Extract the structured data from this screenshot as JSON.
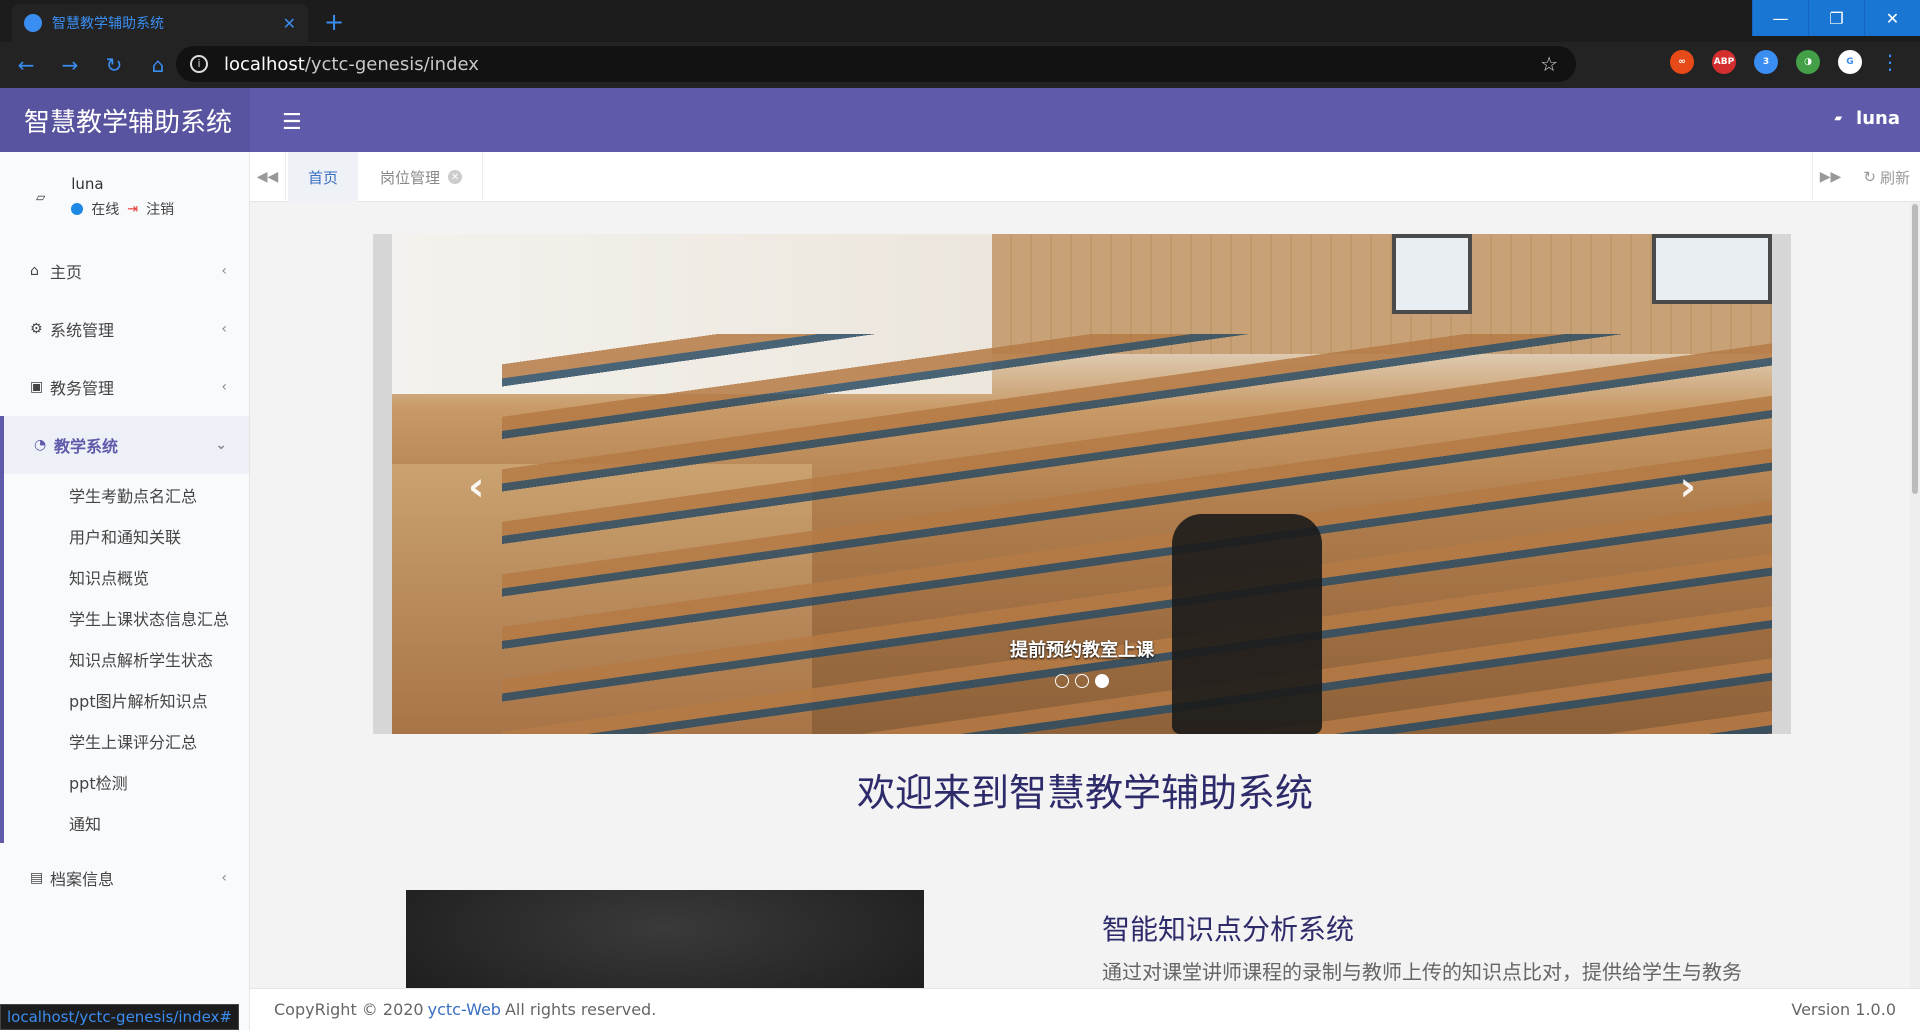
{
  "browser": {
    "tab_title": "智慧教学辅助系统",
    "tab_close": "✕",
    "new_tab": "+",
    "url_host": "localhost",
    "url_path": "/yctc-genesis/index",
    "status_url": "localhost/yctc-genesis/index#",
    "window_controls": {
      "minimize": "—",
      "maximize": "❐",
      "close": "✕"
    },
    "extensions": [
      {
        "name": "infinity-ext-icon",
        "label": "∞",
        "color": "#e64a19"
      },
      {
        "name": "adblock-icon",
        "label": "ABP",
        "color": "#d32f2f"
      },
      {
        "name": "extension-badge-icon",
        "label": "3",
        "color": "#3a8df1"
      },
      {
        "name": "color-ext-icon",
        "label": "◑",
        "color": "#43a047"
      },
      {
        "name": "translate-icon",
        "label": "G",
        "color": "#ffffff"
      }
    ]
  },
  "app": {
    "title": "智慧教学辅助系统",
    "user_top": "luna",
    "accent": "#5f5aa9"
  },
  "sidebar": {
    "user": "luna",
    "online": "在线",
    "logout": "注销",
    "menu": [
      {
        "label": "主页"
      },
      {
        "label": "系统管理"
      },
      {
        "label": "教务管理"
      },
      {
        "label": "教学系统"
      }
    ],
    "submenu": [
      "学生考勤点名汇总",
      "用户和通知关联",
      "知识点概览",
      "学生上课状态信息汇总",
      "知识点解析学生状态",
      "ppt图片解析知识点",
      "学生上课评分汇总",
      "ppt检测",
      "通知"
    ],
    "last_menu": "档案信息"
  },
  "tabs": {
    "home": "首页",
    "job": "岗位管理",
    "refresh": "刷新"
  },
  "carousel": {
    "caption": "提前预约教室上课",
    "slide_count": 3,
    "active_slide": 3
  },
  "main": {
    "welcome": "欢迎来到智慧教学辅助系统",
    "feature_title": "智能知识点分析系统",
    "feature_desc": "通过对课堂讲师课程的录制与教师上传的知识点比对，提供给学生与教务系统详细的知识点分析资料，同时对学生学习状态进行"
  },
  "footer": {
    "copyright_prefix": "CopyRight © 2020",
    "link": "yctc-Web",
    "suffix": "All rights reserved.",
    "version": "Version 1.0.0"
  }
}
